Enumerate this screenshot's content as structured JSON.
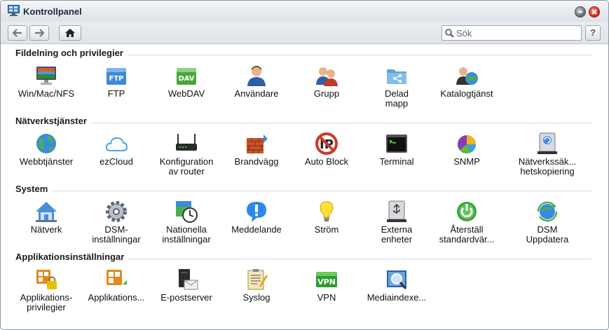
{
  "window": {
    "title": "Kontrollpanel"
  },
  "toolbar": {
    "search_placeholder": "Sök",
    "help_label": "?"
  },
  "sections": [
    {
      "title": "Fildelning och privilegier",
      "items": [
        {
          "label": "Win/Mac/NFS",
          "icon": "monitor-icon"
        },
        {
          "label": "FTP",
          "icon": "ftp-icon"
        },
        {
          "label": "WebDAV",
          "icon": "webdav-icon"
        },
        {
          "label": "Användare",
          "icon": "user-icon"
        },
        {
          "label": "Grupp",
          "icon": "group-icon"
        },
        {
          "label": "Delad\nmapp",
          "icon": "shared-folder-icon"
        },
        {
          "label": "Katalogtjänst",
          "icon": "directory-service-icon"
        }
      ]
    },
    {
      "title": "Nätverkstjänster",
      "items": [
        {
          "label": "Webbtjänster",
          "icon": "globe-icon"
        },
        {
          "label": "ezCloud",
          "icon": "cloud-icon"
        },
        {
          "label": "Konfiguration\nav router",
          "icon": "router-icon"
        },
        {
          "label": "Brandvägg",
          "icon": "firewall-icon"
        },
        {
          "label": "Auto Block",
          "icon": "auto-block-icon"
        },
        {
          "label": "Terminal",
          "icon": "terminal-icon"
        },
        {
          "label": "SNMP",
          "icon": "pie-chart-icon"
        },
        {
          "label": "Nätverkssäk...\nhetskopiering",
          "icon": "network-backup-icon"
        }
      ]
    },
    {
      "title": "System",
      "items": [
        {
          "label": "Nätverk",
          "icon": "network-house-icon"
        },
        {
          "label": "DSM-\ninställningar",
          "icon": "gear-icon"
        },
        {
          "label": "Nationella\ninställningar",
          "icon": "regional-clock-icon"
        },
        {
          "label": "Meddelande",
          "icon": "notification-icon"
        },
        {
          "label": "Ström",
          "icon": "lightbulb-icon"
        },
        {
          "label": "Externa\nenheter",
          "icon": "usb-drive-icon"
        },
        {
          "label": "Återställ\nstandardvär...",
          "icon": "power-restore-icon"
        },
        {
          "label": "DSM\nUppdatera",
          "icon": "update-icon"
        }
      ]
    },
    {
      "title": "Applikationsinställningar",
      "items": [
        {
          "label": "Applikations-\nprivilegier",
          "icon": "app-privileges-icon"
        },
        {
          "label": "Applikations...",
          "icon": "app-portal-icon"
        },
        {
          "label": "E-postserver",
          "icon": "mail-server-icon"
        },
        {
          "label": "Syslog",
          "icon": "syslog-icon"
        },
        {
          "label": "VPN",
          "icon": "vpn-icon"
        },
        {
          "label": "Mediaindexe...",
          "icon": "media-index-icon"
        }
      ]
    }
  ]
}
